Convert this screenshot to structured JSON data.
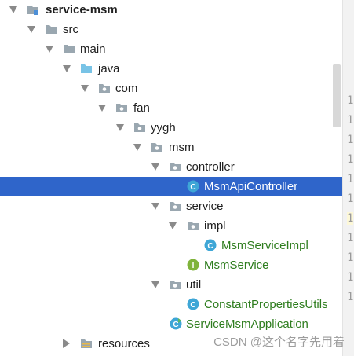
{
  "tree": {
    "root": "service-msm",
    "src": "src",
    "main": "main",
    "java": "java",
    "com": "com",
    "fan": "fan",
    "yygh": "yygh",
    "msm": "msm",
    "controller": "controller",
    "msm_api_controller": "MsmApiController",
    "service": "service",
    "impl": "impl",
    "msm_service_impl": "MsmServiceImpl",
    "msm_service": "MsmService",
    "util": "util",
    "constant_properties_utils": "ConstantPropertiesUtils",
    "service_msm_application": "ServiceMsmApplication",
    "resources": "resources"
  },
  "icon_letters": {
    "class": "C",
    "interface": "I"
  },
  "gutter_numbers": [
    "1",
    "1",
    "1",
    "1",
    "1",
    "1",
    "1",
    "1",
    "1",
    "1",
    "1"
  ],
  "watermark": "CSDN @这个名字先用着",
  "colors": {
    "selection": "#2f65ca",
    "class_icon": "#3ea6d6",
    "interface_icon": "#7fb33a",
    "text_green": "#2e7d1e"
  }
}
